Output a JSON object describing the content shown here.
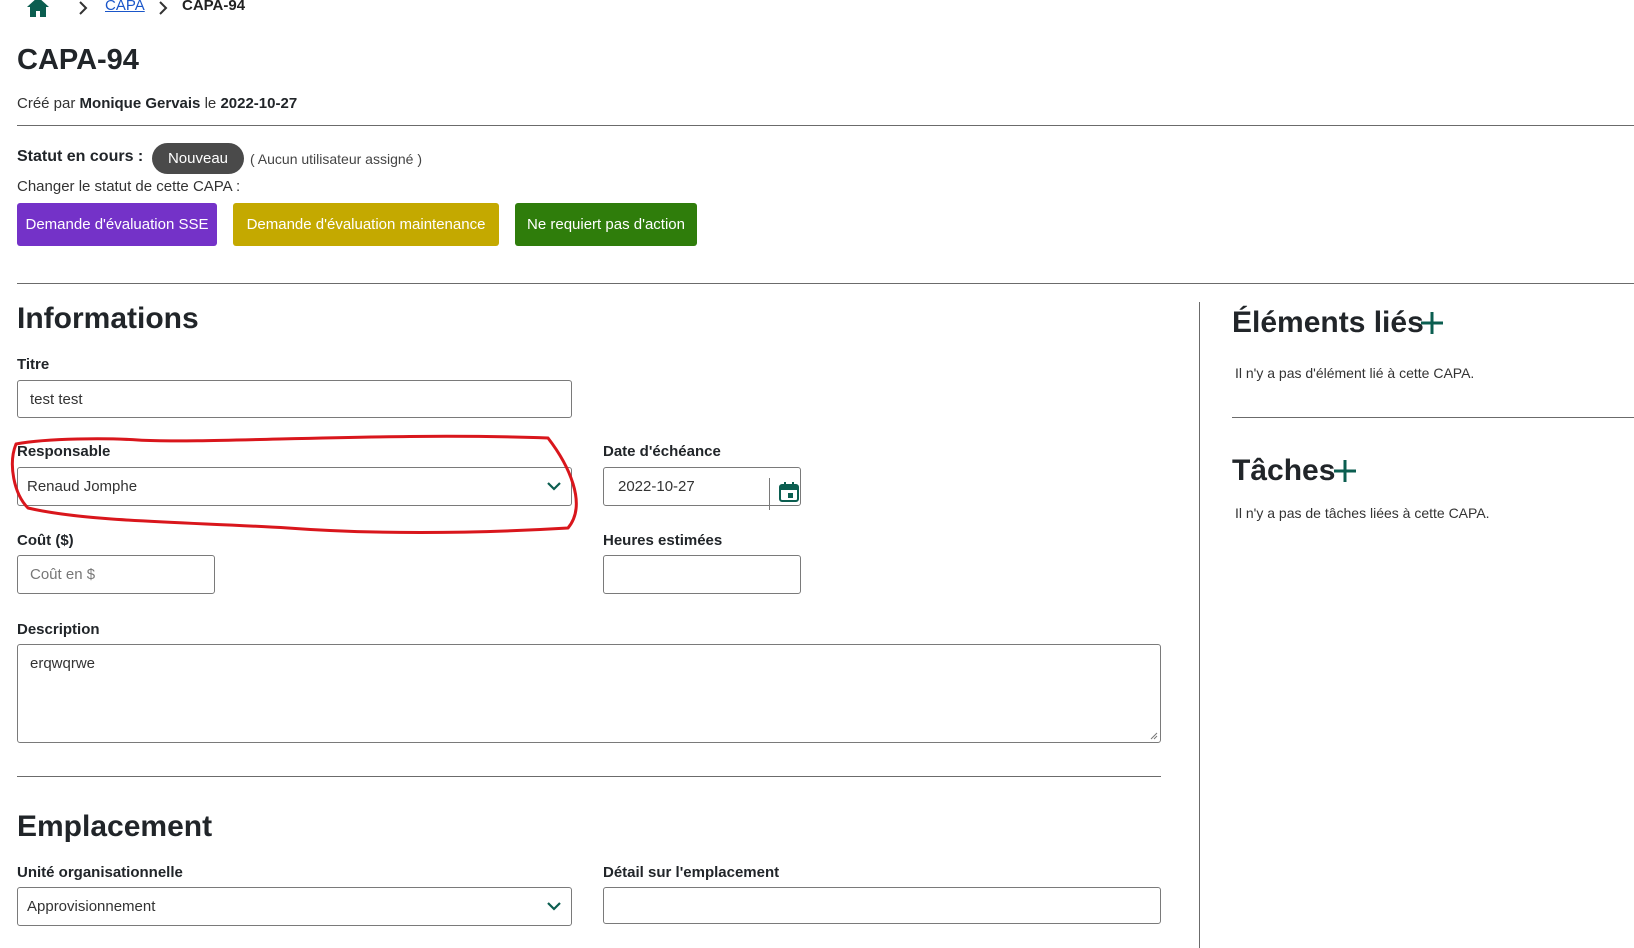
{
  "breadcrumb": {
    "home_icon": "home-icon",
    "separator_icon": "chevron-right-icon",
    "parent": "CAPA",
    "current": "CAPA-94"
  },
  "header": {
    "title": "CAPA-94",
    "created_prefix": "Créé par",
    "created_by": "Monique Gervais",
    "created_mid": "le",
    "created_date": "2022-10-27"
  },
  "status": {
    "label": "Statut en cours :",
    "current": "Nouveau",
    "note": "( Aucun utilisateur assigné )",
    "change_label": "Changer le statut de cette CAPA :",
    "actions": [
      {
        "label": "Demande d'évaluation SSE",
        "color": "#7432c8"
      },
      {
        "label": "Demande d'évaluation maintenance",
        "color": "#c4a900"
      },
      {
        "label": "Ne requiert pas d'action",
        "color": "#2f7d0b"
      }
    ]
  },
  "informations": {
    "section_title": "Informations",
    "title_label": "Titre",
    "title_value": "test test",
    "responsible_label": "Responsable",
    "responsible_value": "Renaud Jomphe",
    "due_label": "Date d'échéance",
    "due_value": "2022-10-27",
    "cost_label": "Coût ($)",
    "cost_placeholder": "Coût en $",
    "hours_label": "Heures estimées",
    "hours_value": "",
    "description_label": "Description",
    "description_value": "erqwqrwe"
  },
  "emplacement": {
    "section_title": "Emplacement",
    "unit_label": "Unité organisationnelle",
    "unit_value": "Approvisionnement",
    "detail_label": "Détail sur l'emplacement",
    "detail_value": ""
  },
  "sidebar": {
    "linked_title": "Éléments liés",
    "linked_empty": "Il n'y a pas d'élément lié à cette CAPA.",
    "tasks_title": "Tâches",
    "tasks_empty": "Il n'y a pas de tâches liées à cette CAPA."
  },
  "theme": {
    "accent": "#0b5e50",
    "annotation": "#d9161c"
  }
}
